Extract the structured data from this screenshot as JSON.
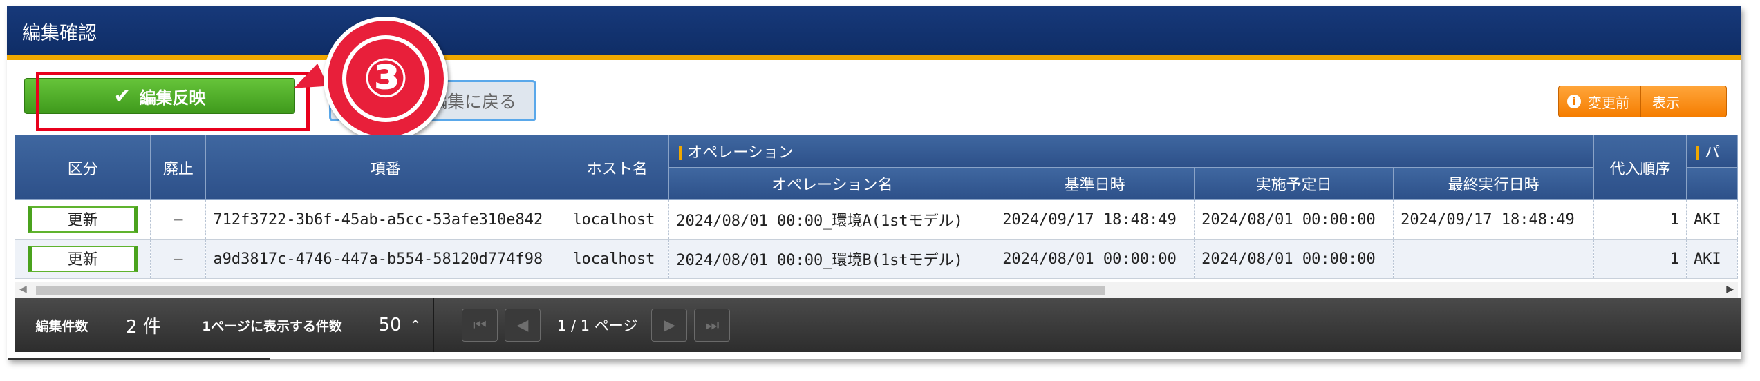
{
  "header": {
    "title": "編集確認"
  },
  "toolbar": {
    "apply_label": "編集反映",
    "back_label": "編集に戻る",
    "diff_label": "変更前",
    "show_label": "表示",
    "callout_number": "③"
  },
  "table": {
    "headers": {
      "kubun": "区分",
      "haishi": "廃止",
      "koban": "項番",
      "host": "ホスト名",
      "operation_group": "オペレーション",
      "operation_name": "オペレーション名",
      "base_datetime": "基準日時",
      "scheduled_datetime": "実施予定日",
      "last_run_datetime": "最終実行日時",
      "substitution_order": "代入順序",
      "next_group": "パ"
    },
    "rows": [
      {
        "kubun": "更新",
        "haishi": "—",
        "koban": "712f3722-3b6f-45ab-a5cc-53afe310e842",
        "host": "localhost",
        "operation_name": "2024/08/01 00:00_環境A(1stモデル)",
        "base_datetime": "2024/09/17 18:48:49",
        "scheduled_datetime": "2024/08/01 00:00:00",
        "last_run_datetime": "2024/09/17 18:48:49",
        "substitution_order": "1",
        "next": "AKI"
      },
      {
        "kubun": "更新",
        "haishi": "—",
        "koban": "a9d3817c-4746-447a-b554-58120d774f98",
        "host": "localhost",
        "operation_name": "2024/08/01 00:00_環境B(1stモデル)",
        "base_datetime": "2024/08/01 00:00:00",
        "scheduled_datetime": "2024/08/01 00:00:00",
        "last_run_datetime": "",
        "substitution_order": "1",
        "next": "AKI"
      }
    ]
  },
  "footer": {
    "count_label": "編集件数",
    "count_value": "2 件",
    "per_page_label": "1ページに表示する件数",
    "per_page_value": "50",
    "page_info": "1 / 1 ページ"
  }
}
